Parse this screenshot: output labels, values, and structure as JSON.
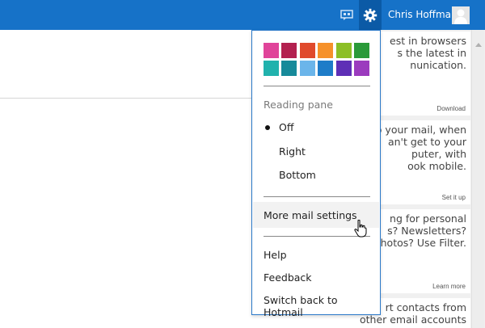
{
  "topbar": {
    "user_name": "Chris Hoffman",
    "icons": [
      "messaging-icon",
      "gear-icon",
      "avatar-icon"
    ],
    "accent": "#1672c8"
  },
  "menu": {
    "themes": [
      "#e0449a",
      "#b3204f",
      "#e04a2c",
      "#f6912a",
      "#8cbf26",
      "#2a9a39",
      "#21b2ad",
      "#178a9a",
      "#6bb5ea",
      "#1e7cc8",
      "#5e2fb6",
      "#9b3bbe"
    ],
    "reading_pane_label": "Reading pane",
    "options": [
      "Off",
      "Right",
      "Bottom"
    ],
    "selected_option": "Off",
    "more_settings": "More mail settings",
    "help": "Help",
    "feedback": "Feedback",
    "switch_back": "Switch back to Hotmail"
  },
  "promos": [
    {
      "text": "est in browsers\ns the latest in\nnunication.",
      "link": "Download"
    },
    {
      "text": "p your mail, when\nan't get to your\nputer, with\nook mobile.",
      "link": "Set it up"
    },
    {
      "text": "ng for personal\ns? Newsletters?\nphotos? Use Filter.",
      "link": "Learn more"
    },
    {
      "text": "rt contacts from\nother email accounts",
      "link": ""
    }
  ]
}
